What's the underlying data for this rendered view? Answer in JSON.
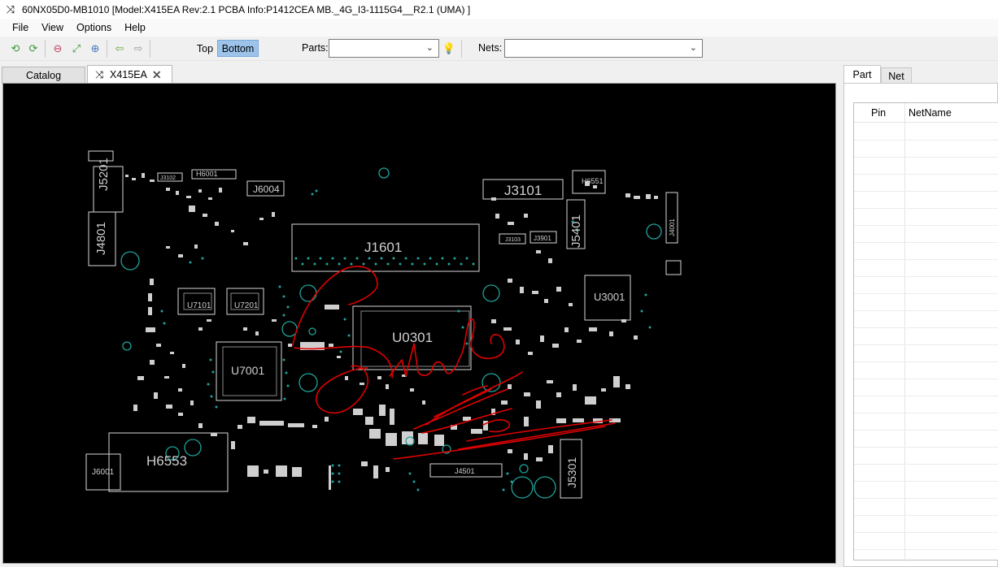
{
  "window": {
    "title": "60NX05D0-MB1010 [Model:X415EA  Rev:2.1 PCBA Info:P1412CEA MB._4G_I3-1115G4__R2.1 (UMA) ]",
    "icon": "shuffle-icon"
  },
  "menu": [
    "File",
    "View",
    "Options",
    "Help"
  ],
  "toolbar": {
    "top_label": "Top",
    "bottom_label": "Bottom",
    "active_layer": "Bottom",
    "parts_label": "Parts:",
    "parts_value": "",
    "nets_label": "Nets:",
    "nets_value": ""
  },
  "tabs": {
    "catalog": "Catalog",
    "board": "X415EA"
  },
  "board": {
    "labels": {
      "j5201": "J5201",
      "j4801": "J4801",
      "h6001": "H6001",
      "j6004": "J6004",
      "j1601": "J1601",
      "j3101": "J3101",
      "h6551": "H6551",
      "j5401": "J5401",
      "j3901": "J3901",
      "u3001": "U3001",
      "u0301": "U0301",
      "u7101": "U7101",
      "u7201": "U7201",
      "u7001": "U7001",
      "h6553": "H6553",
      "j6001": "J6001",
      "j4501": "J4501",
      "j5301": "J5301",
      "j4001": "J4001",
      "j3102": "J3102",
      "j3103": "J3103"
    }
  },
  "right_panel": {
    "tab_part": "Part",
    "tab_net": "Net",
    "col_pin": "Pin",
    "col_netname": "NetName"
  },
  "colors": {
    "board_bg": "#000000",
    "silkscreen": "#d8d8d8",
    "via": "#1fa39a",
    "annotation": "#e00000",
    "active_layer_bg": "#9dc3ea"
  }
}
